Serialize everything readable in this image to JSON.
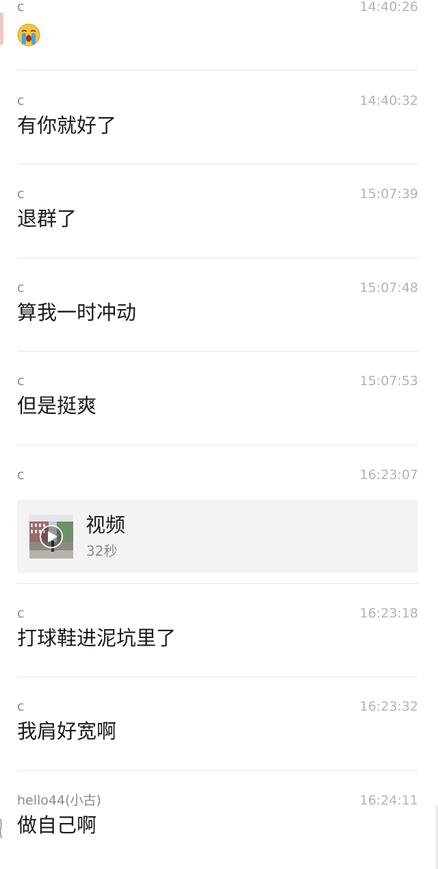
{
  "messages": [
    {
      "sender": "c",
      "time": "14:40:26",
      "type": "emoji",
      "emoji": "crying-face"
    },
    {
      "sender": "c",
      "time": "14:40:32",
      "type": "text",
      "text": "有你就好了"
    },
    {
      "sender": "c",
      "time": "15:07:39",
      "type": "text",
      "text": "退群了"
    },
    {
      "sender": "c",
      "time": "15:07:48",
      "type": "text",
      "text": "算我一时冲动"
    },
    {
      "sender": "c",
      "time": "15:07:53",
      "type": "text",
      "text": "但是挺爽"
    },
    {
      "sender": "c",
      "time": "16:23:07",
      "type": "video",
      "title": "视频",
      "duration": "32秒"
    },
    {
      "sender": "c",
      "time": "16:23:18",
      "type": "text",
      "text": "打球鞋进泥坑里了"
    },
    {
      "sender": "c",
      "time": "16:23:32",
      "type": "text",
      "text": "我肩好宽啊"
    },
    {
      "sender": "hello44(小古)",
      "time": "16:24:11",
      "type": "text",
      "text": "做自己啊"
    }
  ],
  "colors": {
    "sender": "#8a8a8a",
    "time": "#b3b3b3",
    "text": "#1a1a1a",
    "divider": "#e5e5e5",
    "card_bg": "#f3f3f3"
  }
}
